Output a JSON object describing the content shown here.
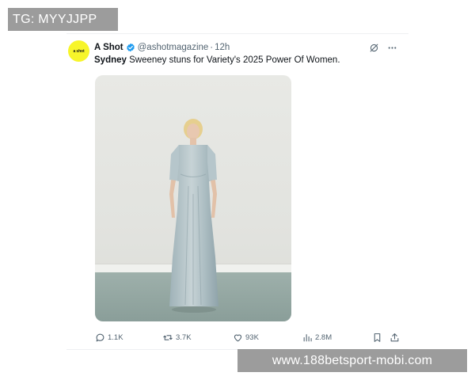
{
  "watermark": {
    "tag": "TG: MYYJJPP",
    "url": "www.188betsport-mobi.com"
  },
  "tweet": {
    "avatar_text": "a shot",
    "avatar_color": "#f7f52a",
    "display_name": "A Shot",
    "verified_color": "#1d9bf0",
    "handle": "@ashotmagazine",
    "separator": "·",
    "timestamp": "12h",
    "text_name": "Sydney",
    "text_rest": " Sweeney stuns for Variety's 2025 Power Of Women.",
    "header_icons": [
      "grok-icon",
      "more-icon"
    ],
    "photo_alt": "woman in sheer silver-blue gown standing against a white wall"
  },
  "actions": {
    "replies": "1.1K",
    "reposts": "3.7K",
    "likes": "93K",
    "views": "2.8M"
  }
}
